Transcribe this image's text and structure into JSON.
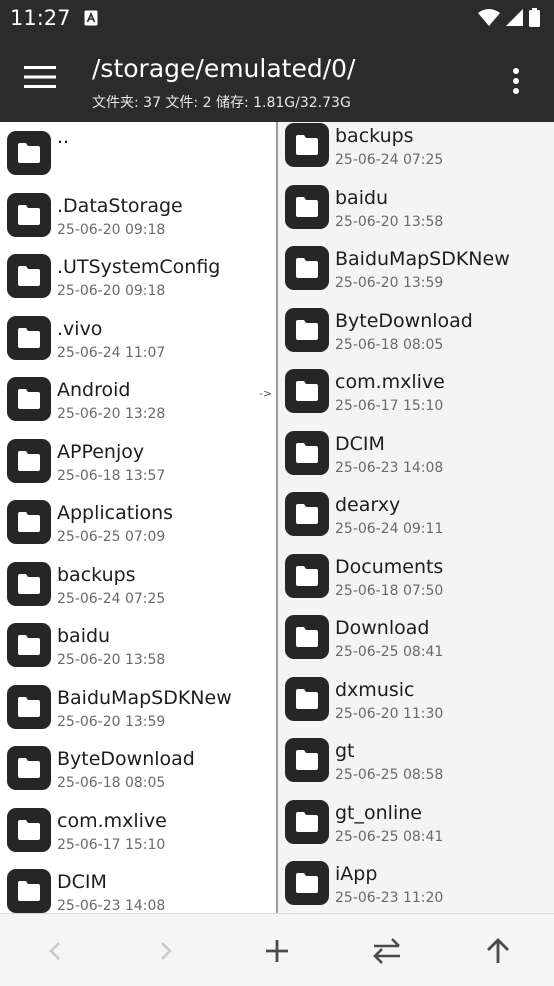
{
  "status_bar": {
    "time": "11:27",
    "icons": [
      "notification-a-icon",
      "wifi-icon",
      "signal-icon",
      "battery-icon"
    ]
  },
  "app_bar": {
    "menu_icon": "hamburger-menu-icon",
    "path": "/storage/emulated/0/",
    "summary": "文件夹: 37  文件: 2  储存: 1.81G/32.73G",
    "more_icon": "more-vert-icon"
  },
  "left_pane": {
    "items": [
      {
        "name": "..",
        "date": ""
      },
      {
        "name": ".DataStorage",
        "date": "25-06-20 09:18"
      },
      {
        "name": ".UTSystemConfig",
        "date": "25-06-20 09:18"
      },
      {
        "name": ".vivo",
        "date": "25-06-24 11:07"
      },
      {
        "name": "Android",
        "date": "25-06-20 13:28"
      },
      {
        "name": "APPenjoy",
        "date": "25-06-18 13:57"
      },
      {
        "name": "Applications",
        "date": "25-06-25 07:09"
      },
      {
        "name": "backups",
        "date": "25-06-24 07:25"
      },
      {
        "name": "baidu",
        "date": "25-06-20 13:58"
      },
      {
        "name": "BaiduMapSDKNew",
        "date": "25-06-20 13:59"
      },
      {
        "name": "ByteDownload",
        "date": "25-06-18 08:05"
      },
      {
        "name": "com.mxlive",
        "date": "25-06-17 15:10"
      },
      {
        "name": "DCIM",
        "date": "25-06-23 14:08"
      }
    ],
    "arrow_hint": "->"
  },
  "right_pane": {
    "items": [
      {
        "name": "backups",
        "date": "25-06-24 07:25"
      },
      {
        "name": "baidu",
        "date": "25-06-20 13:58"
      },
      {
        "name": "BaiduMapSDKNew",
        "date": "25-06-20 13:59"
      },
      {
        "name": "ByteDownload",
        "date": "25-06-18 08:05"
      },
      {
        "name": "com.mxlive",
        "date": "25-06-17 15:10"
      },
      {
        "name": "DCIM",
        "date": "25-06-23 14:08"
      },
      {
        "name": "dearxy",
        "date": "25-06-24 09:11"
      },
      {
        "name": "Documents",
        "date": "25-06-18 07:50"
      },
      {
        "name": "Download",
        "date": "25-06-25 08:41"
      },
      {
        "name": "dxmusic",
        "date": "25-06-20 11:30"
      },
      {
        "name": "gt",
        "date": "25-06-25 08:58"
      },
      {
        "name": "gt_online",
        "date": "25-06-25 08:41"
      },
      {
        "name": "iApp",
        "date": "25-06-23 11:20"
      }
    ]
  },
  "bottom_bar": {
    "buttons": [
      {
        "name": "back-button",
        "icon": "chevron-left-icon",
        "enabled": false
      },
      {
        "name": "forward-button",
        "icon": "chevron-right-icon",
        "enabled": false
      },
      {
        "name": "add-button",
        "icon": "plus-icon",
        "enabled": true
      },
      {
        "name": "swap-panes-button",
        "icon": "swap-arrows-icon",
        "enabled": true
      },
      {
        "name": "parent-directory-button",
        "icon": "arrow-up-icon",
        "enabled": true
      }
    ]
  },
  "colors": {
    "toolbar_bg": "#2b2b2b",
    "folder_tile": "#262626",
    "date_text": "#6a6a6a",
    "disabled_icon": "#c8c8c8",
    "enabled_icon": "#4a4a4a"
  }
}
